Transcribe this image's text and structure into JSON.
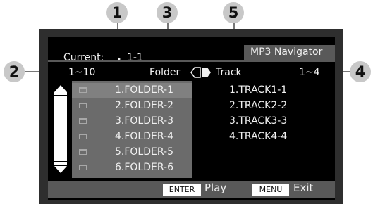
{
  "callouts": [
    "1",
    "2",
    "3",
    "4",
    "5"
  ],
  "header": {
    "title": "MP3 Navigator",
    "current_label": "Current:",
    "current_indicator_icon": "play-triangle-icon",
    "current_value": "1-1"
  },
  "columns": {
    "folder_range": "1~10",
    "folder_label": "Folder",
    "switch_icon": "folder-track-switch-icon",
    "track_label": "Track",
    "track_range": "1~4"
  },
  "folders": [
    {
      "label": "1.FOLDER-1",
      "selected": true
    },
    {
      "label": "2.FOLDER-2",
      "selected": false
    },
    {
      "label": "3.FOLDER-3",
      "selected": false
    },
    {
      "label": "4.FOLDER-4",
      "selected": false
    },
    {
      "label": "5.FOLDER-5",
      "selected": false
    },
    {
      "label": "6.FOLDER-6",
      "selected": false
    }
  ],
  "tracks": [
    "1.TRACK1-1",
    "2.TRACK2-2",
    "3.TRACK3-3",
    "4.TRACK4-4"
  ],
  "footer": {
    "enter_key": "ENTER",
    "enter_action": "Play",
    "menu_key": "MENU",
    "menu_action": "Exit"
  },
  "colors": {
    "screen": "#000000",
    "bar": "#595959",
    "list_bg": "#6b6b6b",
    "callout": "#c8c8c8"
  }
}
